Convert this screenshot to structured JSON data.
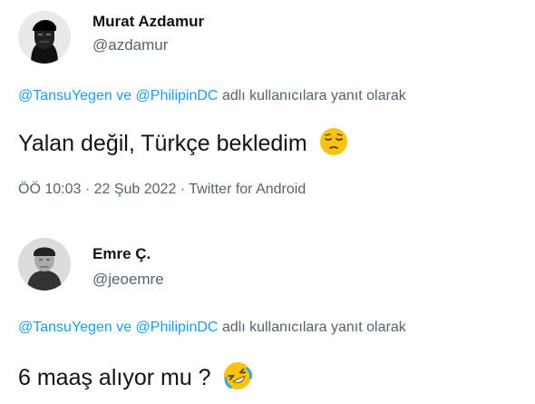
{
  "tweets": [
    {
      "name": "Murat Azdamur",
      "handle": "@azdamur",
      "reply": {
        "mention1": "@TansuYegen",
        "ve": "ve",
        "mention2": "@PhilipinDC",
        "suffix": "adlı kullanıcılara yanıt olarak"
      },
      "text": "Yalan değil, Türkçe bekledim",
      "emoji": "pensive-face",
      "meta": "ÖÖ 10:03 · 22 Şub 2022 · Twitter for Android"
    },
    {
      "name": "Emre Ç.",
      "handle": "@jeoemre",
      "reply": {
        "mention1": "@TansuYegen",
        "ve": "ve",
        "mention2": "@PhilipinDC",
        "suffix": "adlı kullanıcılara yanıt olarak"
      },
      "text": "6 maaş alıyor mu ?",
      "emoji": "rolling-on-floor-laughing-face"
    }
  ],
  "colors": {
    "link": "#1d9bf0",
    "secondary": "#536471",
    "primary": "#0f1419",
    "emoji": "#f9c40f"
  }
}
